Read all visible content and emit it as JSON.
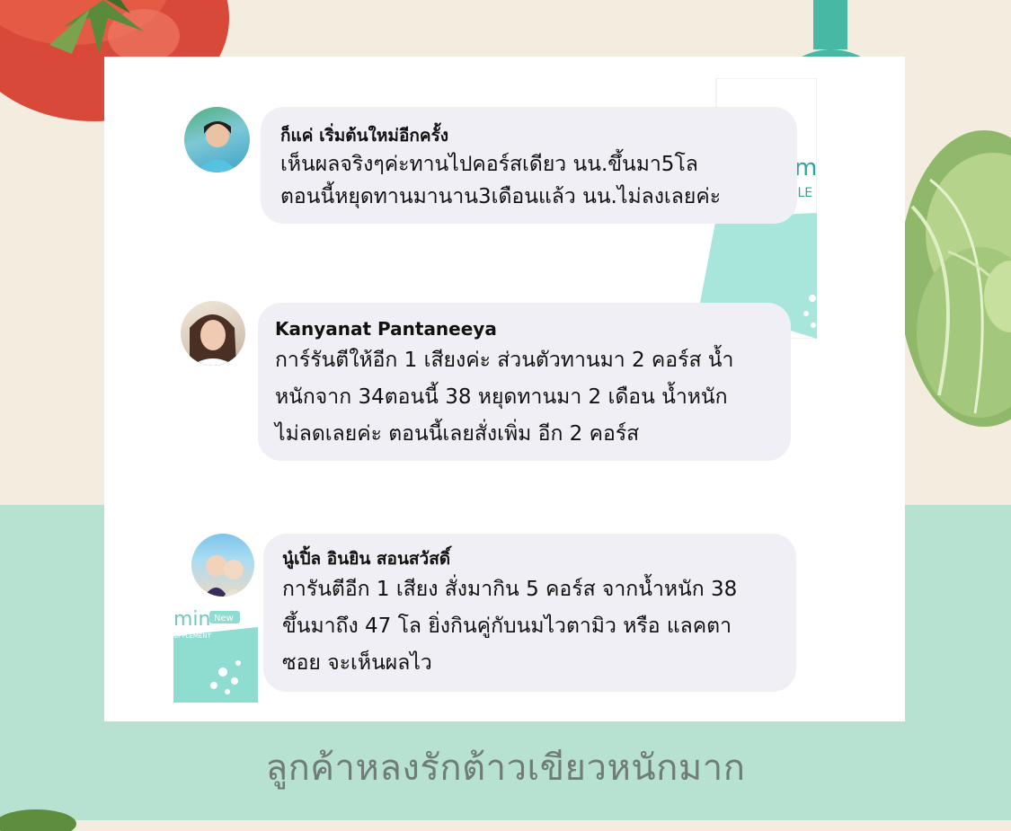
{
  "comments": [
    {
      "name": "ก็แค่ เริ่มต้นใหม่อีกครั้ง",
      "lines": [
        "เห็นผลจริงๆค่ะทานไปคอร์สเดียว นน.ขึ้นมา5โล",
        "ตอนนี้หยุดทานมานาน3เดือนแล้ว นน.ไม่ลงเลยค่ะ"
      ]
    },
    {
      "name": "Kanyanat Pantaneeya",
      "lines": [
        "การ์รันตีให้อีก 1 เสียงค่ะ ส่วนตัวทานมา 2 คอร์ส น้ำ",
        "หนักจาก 34ตอนนี้ 38 หยุดทานมา 2 เดือน น้ำหนัก",
        "ไม่ลดเลยค่ะ ตอนนี้เลยสั่งเพิ่ม อีก 2 คอร์ส"
      ]
    },
    {
      "name": "นู๋เปิ้ล อินยิน สอนสวัสดิ์",
      "lines": [
        "การันตีอีก 1 เสียง  สั่งมากิน 5 คอร์ส  จากน้ำหนัก 38",
        "ขึ้นมาถึง 47 โล  ยิ่งกินคู่กับนมไวตามิว หรือ แลคตา",
        "ซอย จะเห็นผลไว"
      ]
    }
  ],
  "product_labels": {
    "top": "m",
    "top_sub": "PLE",
    "bottom": "min",
    "bottom_badge": "New",
    "bottom_sub": "UPPLEMENT"
  },
  "caption": "ลูกค้าหลงรักต้าวเขียวหนักมาก",
  "colors": {
    "background_top": "#f4ecdf",
    "background_bottom": "#b7e2d2",
    "card": "#ffffff",
    "bubble": "#efeff5",
    "caption_text": "#6f7c77",
    "product_teal": "#a8e6dc"
  }
}
